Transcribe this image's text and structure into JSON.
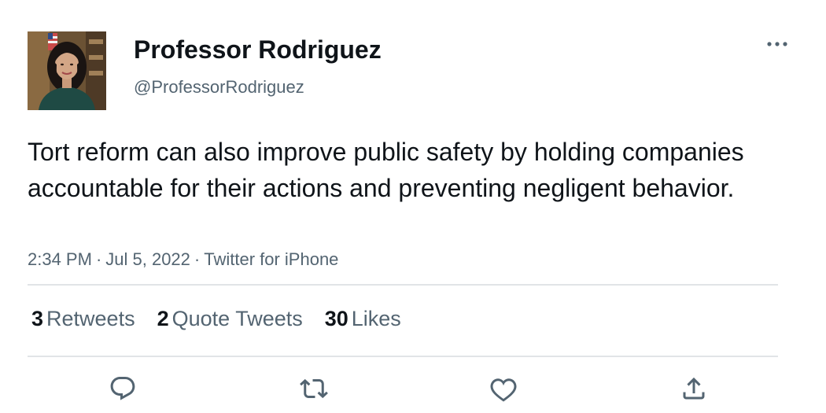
{
  "author": {
    "display_name": "Professor Rodriguez",
    "handle": "@ProfessorRodriguez",
    "avatar_icon": "profile-photo"
  },
  "tweet": {
    "text": "Tort reform can also improve public safety by holding companies accountable for their actions and preventing negligent behavior.",
    "time": "2:34 PM",
    "date": "Jul 5, 2022",
    "source": "Twitter for iPhone",
    "separator": "·"
  },
  "stats": {
    "retweets": {
      "count": "3",
      "label": "Retweets"
    },
    "quotes": {
      "count": "2",
      "label": "Quote Tweets"
    },
    "likes": {
      "count": "30",
      "label": "Likes"
    }
  },
  "actions": {
    "reply_icon": "reply-icon",
    "retweet_icon": "retweet-icon",
    "like_icon": "heart-icon",
    "share_icon": "share-icon"
  },
  "colors": {
    "text_primary": "#0f1419",
    "text_secondary": "#536471",
    "divider": "#e1e4e7",
    "icon": "#536471"
  }
}
